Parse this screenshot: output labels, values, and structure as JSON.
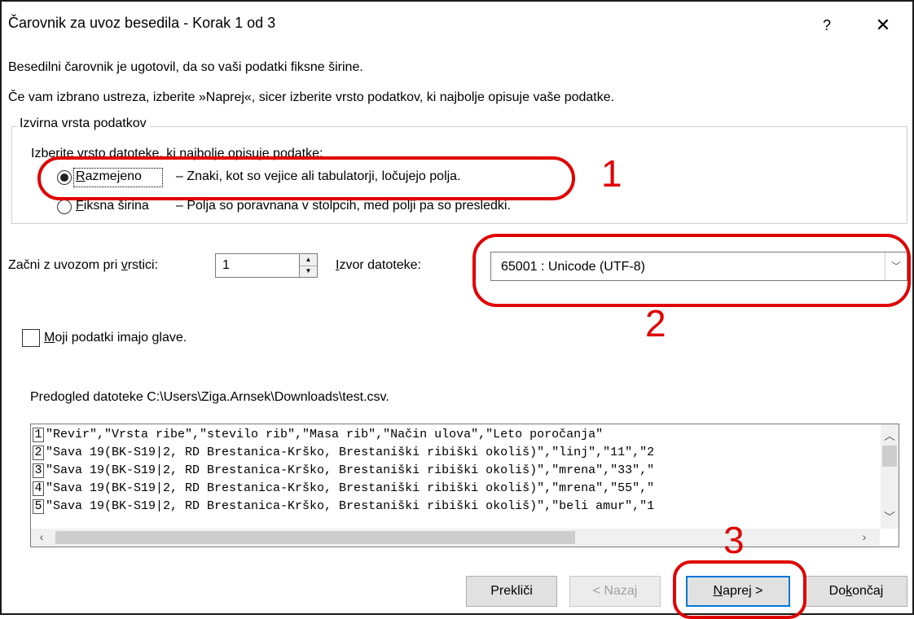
{
  "window": {
    "title": "Čarovnik za uvoz besedila - Korak 1 od 3",
    "help_glyph": "?",
    "close_glyph": "✕"
  },
  "intro": {
    "line1": "Besedilni čarovnik je ugotovil, da so vaši podatki fiksne širine.",
    "line2": "Če vam izbrano ustreza, izberite »Naprej«, sicer izberite vrsto podatkov, ki najbolje opisuje vaše podatke."
  },
  "group": {
    "legend": "Izvirna vrsta podatkov",
    "prompt": "Izberite vrsto datoteke, ki najbolje opisuje podatke:",
    "options": [
      {
        "label": "Razmejeno",
        "description": "– Znaki, kot so vejice ali tabulatorji, ločujejo polja.",
        "selected": true
      },
      {
        "label": "Fiksna širina",
        "description": "– Polja so poravnana v stolpcih, med polji pa so presledki.",
        "selected": false
      }
    ]
  },
  "start_row": {
    "label": "Začni z uvozom pri vrstici:",
    "value": "1"
  },
  "file_origin": {
    "label": "Izvor datoteke:",
    "value": "65001 : Unicode (UTF-8)"
  },
  "headers_checkbox": {
    "label": "Moji podatki imajo glave.",
    "checked": false
  },
  "preview": {
    "label": "Predogled datoteke C:\\Users\\Ziga.Arnsek\\Downloads\\test.csv.",
    "lines": [
      {
        "num": "1",
        "text": "\"Revir\",\"Vrsta ribe\",\"stevilo rib\",\"Masa rib\",\"Način ulova\",\"Leto poročanja\""
      },
      {
        "num": "2",
        "text": "\"Sava 19(BK-S19|2, RD Brestanica-Krško, Brestaniški ribiški okoliš)\",\"linj\",\"11\",\"2"
      },
      {
        "num": "3",
        "text": "\"Sava 19(BK-S19|2, RD Brestanica-Krško, Brestaniški ribiški okoliš)\",\"mrena\",\"33\",\""
      },
      {
        "num": "4",
        "text": "\"Sava 19(BK-S19|2, RD Brestanica-Krško, Brestaniški ribiški okoliš)\",\"mrena\",\"55\",\""
      },
      {
        "num": "5",
        "text": "\"Sava 19(BK-S19|2, RD Brestanica-Krško, Brestaniški ribiški okoliš)\",\"beli amur\",\"1"
      }
    ]
  },
  "buttons": {
    "cancel": "Prekliči",
    "back": "< Nazaj",
    "next": "Naprej >",
    "finish": "Dokončaj"
  },
  "annotations": {
    "n1": "1",
    "n2": "2",
    "n3": "3"
  },
  "colors": {
    "annotation": "#e00000",
    "focus": "#0078d7"
  }
}
